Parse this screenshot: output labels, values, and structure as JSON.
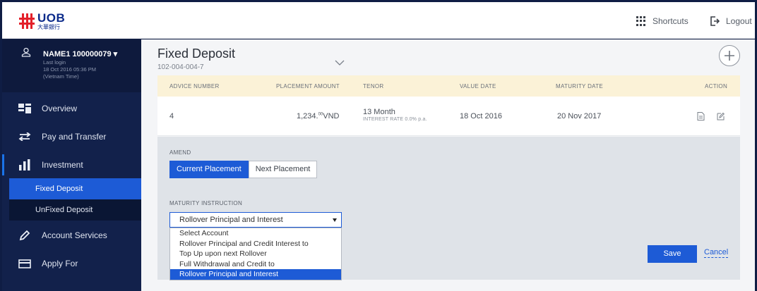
{
  "brand": {
    "name": "UOB",
    "subtitle": "大華銀行"
  },
  "header": {
    "shortcuts_label": "Shortcuts",
    "logout_label": "Logout"
  },
  "user": {
    "name": "NAME1 100000079",
    "last_login_label": "Last login",
    "last_login_time": "18 Oct 2016 05:36 PM",
    "timezone": "(Vietnam Time)"
  },
  "sidebar": {
    "items": [
      {
        "label": "Overview",
        "icon": "overview-icon"
      },
      {
        "label": "Pay and Transfer",
        "icon": "transfer-icon"
      },
      {
        "label": "Investment",
        "icon": "investment-icon"
      },
      {
        "label": "Account Services",
        "icon": "pencil-icon"
      },
      {
        "label": "Apply For",
        "icon": "card-icon"
      }
    ],
    "sub_items": [
      {
        "label": "Fixed Deposit",
        "active": true
      },
      {
        "label": "UnFixed Deposit",
        "active": false
      }
    ]
  },
  "main": {
    "title": "Fixed Deposit",
    "account_number": "102-004-004-7",
    "table": {
      "headers": [
        "ADVICE NUMBER",
        "PLACEMENT AMOUNT",
        "TENOR",
        "VALUE DATE",
        "MATURITY DATE",
        "ACTION"
      ],
      "row": {
        "advice_number": "4",
        "amount": "1,234.",
        "amount_decimals": "00",
        "currency": "VND",
        "tenor": "13 Month",
        "interest_rate": "INTEREST RATE 0.0% p.a.",
        "value_date": "18 Oct 2016",
        "maturity_date": "20 Nov 2017"
      }
    },
    "amend": {
      "label": "AMEND",
      "options": [
        "Current Placement",
        "Next Placement"
      ],
      "selected": "Current Placement"
    },
    "maturity": {
      "label": "MATURITY INSTRUCTION",
      "selected": "Rollover Principal and Interest",
      "options": [
        "Select Account",
        "Rollover Principal and Credit Interest to",
        "Top Up upon next Rollover",
        "Full Withdrawal and Credit to",
        "Rollover Principal and Interest"
      ]
    },
    "save_label": "Save",
    "cancel_label": "Cancel"
  },
  "colors": {
    "accent": "#1d5bd6",
    "sidebar": "#12214b",
    "brand_red": "#e3202a",
    "brand_blue": "#0b2a8a"
  }
}
